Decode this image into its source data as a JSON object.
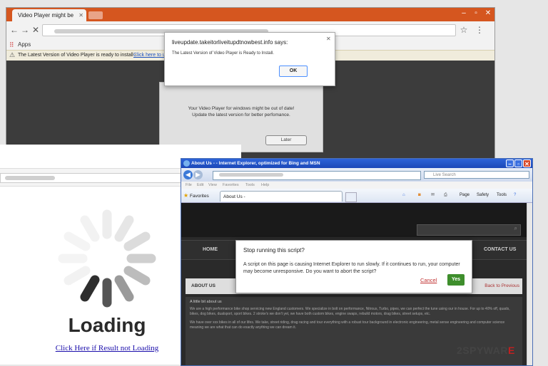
{
  "chrome": {
    "tab_title": "Video Player might be",
    "apps_label": "Apps",
    "infobar_text": "The Latest Version of Video Player is ready to install -",
    "infobar_link": "Click here to u"
  },
  "alert": {
    "title": "liveupdate.takeitorliveitupdtnowbest.info says:",
    "message": "The Latest Version of Video Player is Ready to Install.",
    "ok_label": "OK"
  },
  "update_panel": {
    "line1": "Your Video Player for windows might be out of date!",
    "line2": "Update the latest version for better perfomance.",
    "later_label": "Later"
  },
  "loading_page": {
    "loading_text": "Loading",
    "link_text": "Click Here if Result not Loading"
  },
  "ie": {
    "title": "About Us - - Internet Explorer, optimized for Bing and MSN",
    "search_placeholder": "Live Search",
    "menu": [
      "File",
      "Edit",
      "View",
      "Favorites",
      "Tools",
      "Help"
    ],
    "favorites_label": "Favorites",
    "tab_label": "About Us -",
    "tools": [
      "Page",
      "Safety",
      "Tools"
    ],
    "nav_home": "HOME",
    "nav_contact": "CONTACT US",
    "about_heading": "ABOUT US",
    "back_link": "Back to Previous",
    "body_heading": "A little bit about us",
    "body_text": "We are a high performance bike shop servicing new England customers. We specialize in bolt on performance, Nitrous, Turbo, pipes, we can perfect the tune using our in house. For up to 40% off, quads, bikes, dog bikes, dualsport, sport bikes. 2 stroke's we don't yet, we have both custom bikes, engine swaps, rebuild motors, drag bikes, street setups, etc.",
    "body_text2": "We have over xxx bikes in all of our lifes. We take, street riding, drag racing and tour everything with a robust tour background in electronic engineering, metal sense engineering and computer science meaning we are what that can do exactly anything we can dream it."
  },
  "script_dialog": {
    "title": "Stop running this script?",
    "message": "A script on this page is causing Internet Explorer to run slowly. If it continues to run, your computer may become unresponsive. Do you want to abort the script?",
    "cancel_label": "Cancel",
    "yes_label": "Yes"
  },
  "watermark": {
    "prefix": "2SPYWAR",
    "suffix": "E"
  },
  "colors": {
    "chrome_frame": "#d5561f",
    "ie_title": "#2d63d8",
    "yes_button": "#3e8e2c",
    "cancel_link": "#c03030"
  }
}
